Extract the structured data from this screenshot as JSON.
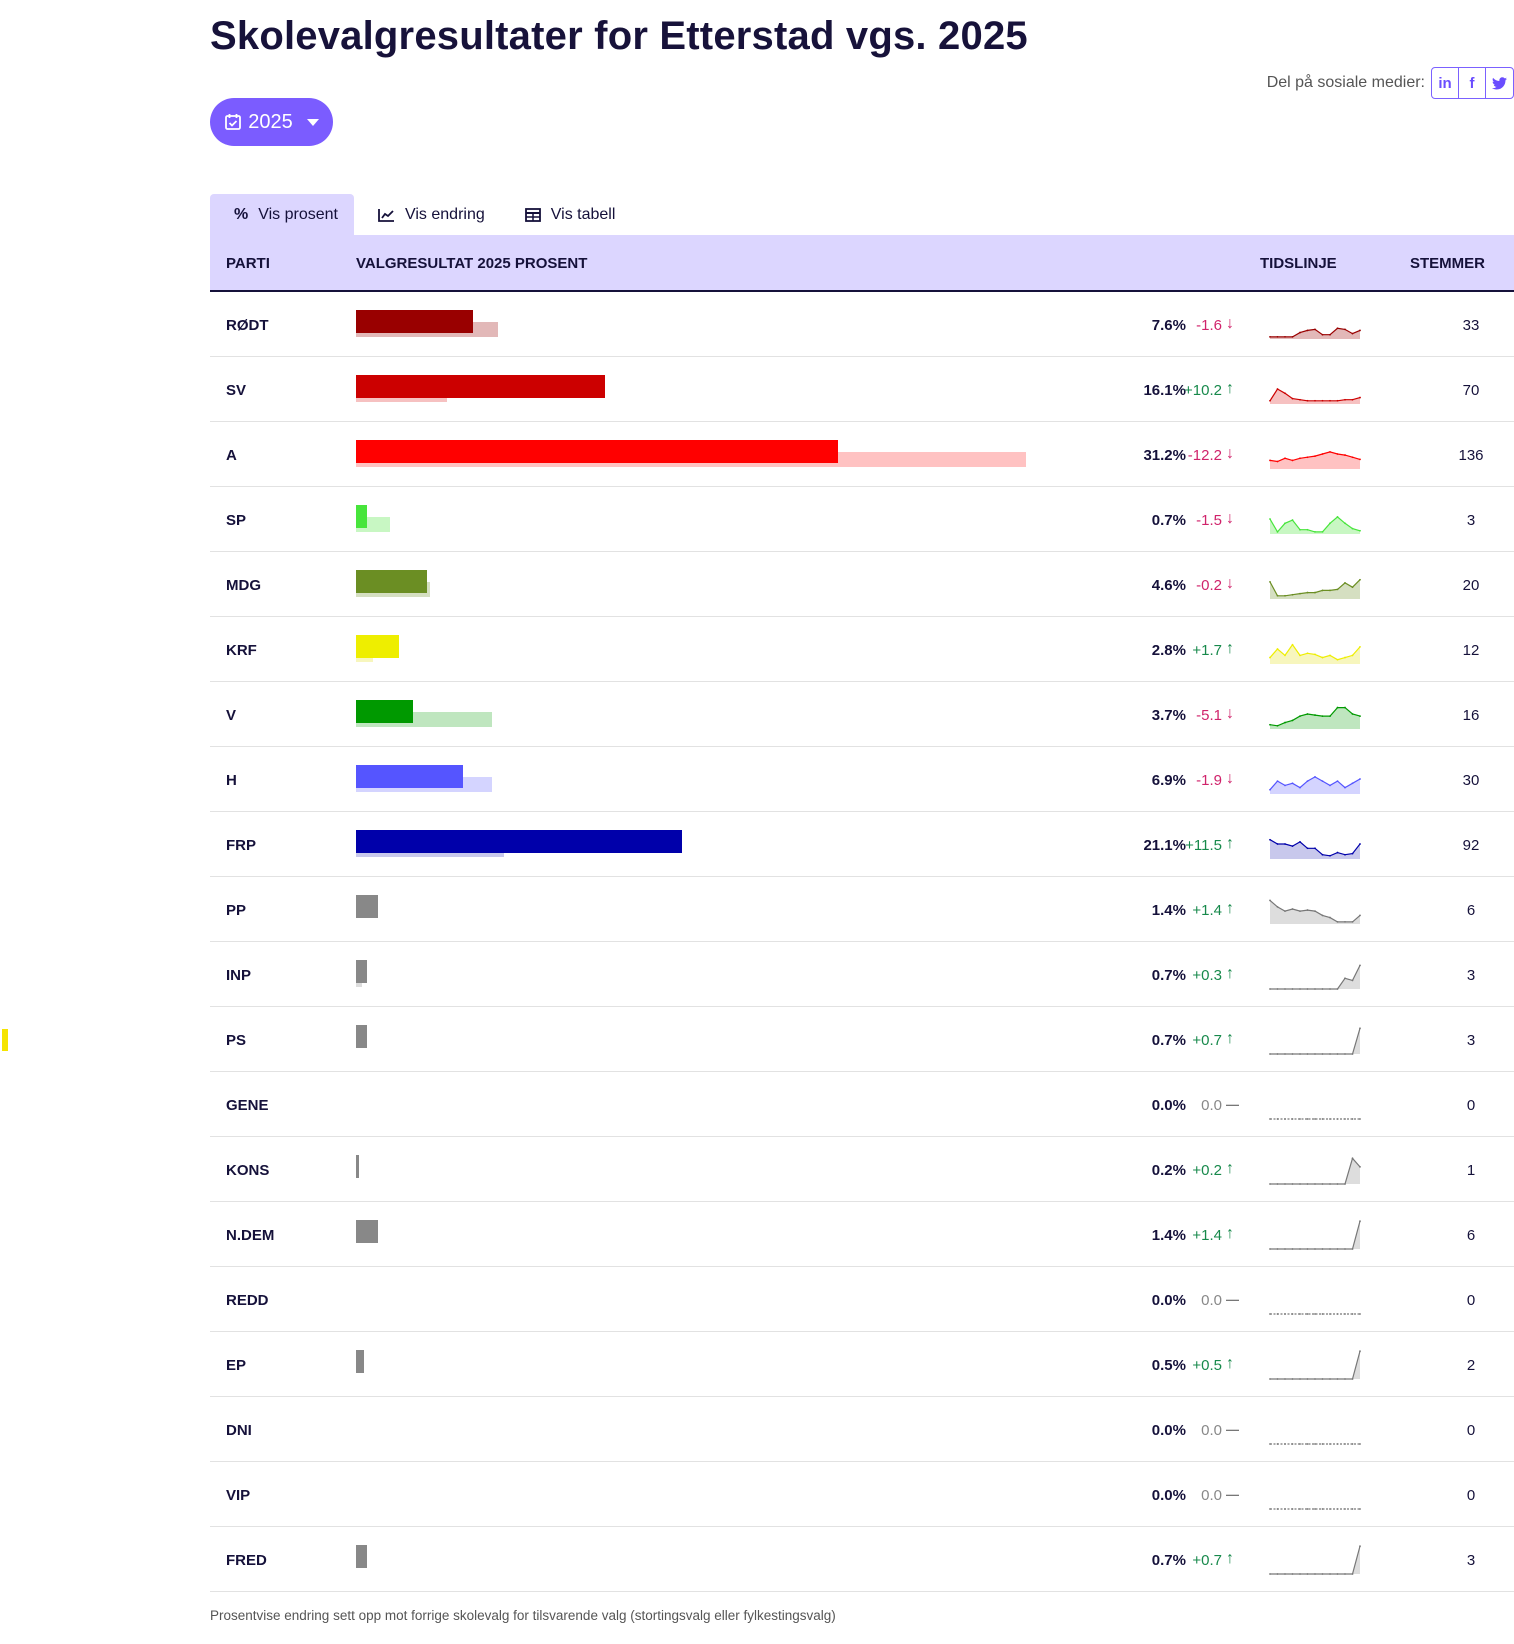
{
  "title": "Skolevalgresultater for Etterstad vgs. 2025",
  "share": {
    "label": "Del på sosiale medier:",
    "buttons": [
      {
        "icon": "linkedin-icon",
        "glyph": "in"
      },
      {
        "icon": "facebook-icon",
        "glyph": "f"
      },
      {
        "icon": "twitter-icon",
        "glyph": "🐦"
      }
    ]
  },
  "year_selector": {
    "value": "2025",
    "icon": "calendar-check-icon"
  },
  "tabs": [
    {
      "label": "Vis prosent",
      "icon": "percent-icon",
      "glyph": "%",
      "active": true
    },
    {
      "label": "Vis endring",
      "icon": "line-chart-icon",
      "glyph": "📈",
      "active": false
    },
    {
      "label": "Vis tabell",
      "icon": "table-icon",
      "glyph": "▦",
      "active": false
    }
  ],
  "table": {
    "headers": {
      "party": "PARTI",
      "result": "VALGRESULTAT 2025 PROSENT",
      "timeline": "TIDSLINJE",
      "votes": "STEMMER"
    },
    "max_percent": 43.4,
    "rows": [
      {
        "party": "RØDT",
        "pct": "7.6%",
        "value": 7.6,
        "prev": 9.2,
        "change": "-1.6",
        "dir": "down",
        "votes": "33",
        "color": "#990000",
        "light": "#e2b8b8",
        "spark": [
          2,
          2,
          2,
          2,
          6,
          8,
          9,
          4,
          4,
          10,
          9,
          5,
          8
        ]
      },
      {
        "party": "SV",
        "pct": "16.1%",
        "value": 16.1,
        "prev": 5.9,
        "change": "+10.2",
        "dir": "up",
        "votes": "70",
        "color": "#cc0000",
        "light": "#f6c1c1",
        "spark": [
          3,
          14,
          10,
          5,
          4,
          3,
          3,
          3,
          3,
          3,
          4,
          4,
          6
        ]
      },
      {
        "party": "A",
        "pct": "31.2%",
        "value": 31.2,
        "prev": 43.4,
        "change": "-12.2",
        "dir": "down",
        "votes": "136",
        "color": "#ff0000",
        "light": "#ffc2c2",
        "spark": [
          8,
          7,
          10,
          8,
          10,
          11,
          12,
          14,
          16,
          14,
          13,
          11,
          9
        ]
      },
      {
        "party": "SP",
        "pct": "0.7%",
        "value": 0.7,
        "prev": 2.2,
        "change": "-1.5",
        "dir": "down",
        "votes": "3",
        "color": "#47e53b",
        "light": "#c8f7c3",
        "spark": [
          14,
          2,
          10,
          13,
          4,
          4,
          2,
          2,
          10,
          16,
          10,
          5,
          3
        ]
      },
      {
        "party": "MDG",
        "pct": "4.6%",
        "value": 4.6,
        "prev": 4.8,
        "change": "-0.2",
        "dir": "down",
        "votes": "20",
        "color": "#6b8e23",
        "light": "#d5dfc1",
        "spark": [
          16,
          3,
          3,
          4,
          5,
          6,
          6,
          8,
          8,
          9,
          15,
          11,
          18
        ]
      },
      {
        "party": "KRF",
        "pct": "2.8%",
        "value": 2.8,
        "prev": 1.1,
        "change": "+1.7",
        "dir": "up",
        "votes": "12",
        "color": "#eeee00",
        "light": "#f7f6bd",
        "spark": [
          6,
          14,
          8,
          18,
          8,
          10,
          9,
          6,
          8,
          4,
          6,
          8,
          16
        ]
      },
      {
        "party": "V",
        "pct": "3.7%",
        "value": 3.7,
        "prev": 8.8,
        "change": "-5.1",
        "dir": "down",
        "votes": "16",
        "color": "#009900",
        "light": "#bfe6bf",
        "spark": [
          4,
          3,
          6,
          8,
          12,
          14,
          13,
          12,
          12,
          20,
          20,
          14,
          12
        ]
      },
      {
        "party": "H",
        "pct": "6.9%",
        "value": 6.9,
        "prev": 8.8,
        "change": "-1.9",
        "dir": "down",
        "votes": "30",
        "color": "#5555ff",
        "light": "#d4d4ff",
        "spark": [
          4,
          12,
          8,
          10,
          6,
          12,
          16,
          12,
          8,
          12,
          6,
          10,
          14
        ]
      },
      {
        "party": "FRP",
        "pct": "21.1%",
        "value": 21.1,
        "prev": 9.6,
        "change": "+11.5",
        "dir": "up",
        "votes": "92",
        "color": "#0000aa",
        "light": "#c8c8ec",
        "spark": [
          18,
          14,
          14,
          12,
          16,
          10,
          10,
          4,
          3,
          6,
          4,
          5,
          14
        ]
      },
      {
        "party": "PP",
        "pct": "1.4%",
        "value": 1.4,
        "prev": 0,
        "change": "+1.4",
        "dir": "up",
        "votes": "6",
        "color": "#888888",
        "light": "#dddddd",
        "spark": [
          22,
          16,
          12,
          14,
          12,
          13,
          12,
          8,
          6,
          2,
          2,
          2,
          8
        ]
      },
      {
        "party": "INP",
        "pct": "0.7%",
        "value": 0.7,
        "prev": 0.4,
        "change": "+0.3",
        "dir": "up",
        "votes": "3",
        "color": "#888888",
        "light": "#dddddd",
        "spark": [
          0,
          0,
          0,
          0,
          0,
          0,
          0,
          0,
          0,
          0,
          10,
          8,
          22
        ]
      },
      {
        "party": "PS",
        "pct": "0.7%",
        "value": 0.7,
        "prev": 0,
        "change": "+0.7",
        "dir": "up",
        "votes": "3",
        "color": "#888888",
        "light": "#dddddd",
        "spark": [
          0,
          0,
          0,
          0,
          0,
          0,
          0,
          0,
          0,
          0,
          0,
          0,
          24
        ]
      },
      {
        "party": "GENE",
        "pct": "0.0%",
        "value": 0,
        "prev": 0,
        "change": "0.0",
        "dir": "zero",
        "votes": "0",
        "color": "#888888",
        "light": "#dddddd",
        "spark": [
          0,
          0,
          0,
          0,
          0,
          0,
          0,
          0,
          0,
          0,
          0,
          0,
          0
        ]
      },
      {
        "party": "KONS",
        "pct": "0.2%",
        "value": 0.2,
        "prev": 0,
        "change": "+0.2",
        "dir": "up",
        "votes": "1",
        "color": "#888888",
        "light": "#dddddd",
        "spark": [
          0,
          0,
          0,
          0,
          0,
          0,
          0,
          0,
          0,
          0,
          0,
          24,
          16
        ]
      },
      {
        "party": "N.DEM",
        "pct": "1.4%",
        "value": 1.4,
        "prev": 0,
        "change": "+1.4",
        "dir": "up",
        "votes": "6",
        "color": "#888888",
        "light": "#dddddd",
        "spark": [
          0,
          0,
          0,
          0,
          0,
          0,
          0,
          0,
          0,
          0,
          0,
          0,
          26
        ]
      },
      {
        "party": "REDD",
        "pct": "0.0%",
        "value": 0,
        "prev": 0,
        "change": "0.0",
        "dir": "zero",
        "votes": "0",
        "color": "#888888",
        "light": "#dddddd",
        "spark": [
          0,
          0,
          0,
          0,
          0,
          0,
          0,
          0,
          0,
          0,
          0,
          0,
          0
        ]
      },
      {
        "party": "EP",
        "pct": "0.5%",
        "value": 0.5,
        "prev": 0,
        "change": "+0.5",
        "dir": "up",
        "votes": "2",
        "color": "#888888",
        "light": "#dddddd",
        "spark": [
          0,
          0,
          0,
          0,
          0,
          0,
          0,
          0,
          0,
          0,
          0,
          0,
          26
        ]
      },
      {
        "party": "DNI",
        "pct": "0.0%",
        "value": 0,
        "prev": 0,
        "change": "0.0",
        "dir": "zero",
        "votes": "0",
        "color": "#888888",
        "light": "#dddddd",
        "spark": [
          0,
          0,
          0,
          0,
          0,
          0,
          0,
          0,
          0,
          0,
          0,
          0,
          0
        ]
      },
      {
        "party": "VIP",
        "pct": "0.0%",
        "value": 0,
        "prev": 0,
        "change": "0.0",
        "dir": "zero",
        "votes": "0",
        "color": "#888888",
        "light": "#dddddd",
        "spark": [
          0,
          0,
          0,
          0,
          0,
          0,
          0,
          0,
          0,
          0,
          0,
          0,
          0
        ]
      },
      {
        "party": "FRED",
        "pct": "0.7%",
        "value": 0.7,
        "prev": 0,
        "change": "+0.7",
        "dir": "up",
        "votes": "3",
        "color": "#888888",
        "light": "#dddddd",
        "spark": [
          0,
          0,
          0,
          0,
          0,
          0,
          0,
          0,
          0,
          0,
          0,
          0,
          26
        ]
      }
    ]
  },
  "footnote": "Prosentvise endring sett opp mot forrige skolevalg for tilsvarende valg (stortingsvalg eller fylkestingsvalg)"
}
